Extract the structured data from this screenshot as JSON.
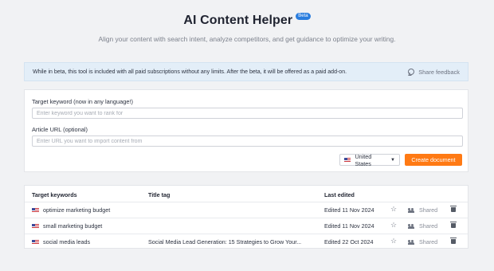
{
  "header": {
    "title": "AI Content Helper",
    "badge": "Beta",
    "subtitle": "Align your content with search intent, analyze competitors, and get guidance to optimize your writing."
  },
  "banner": {
    "text": "While in beta, this tool is included with all paid subscriptions without any limits. After the beta, it will be offered as a paid add-on.",
    "feedback_label": "Share feedback"
  },
  "form": {
    "keyword_label": "Target keyword (now in any language!)",
    "keyword_placeholder": "Enter keyword you want to rank for",
    "keyword_value": "",
    "url_label": "Article URL (optional)",
    "url_placeholder": "Enter URL you want to import content from",
    "url_value": "",
    "country": "United States",
    "create_label": "Create document"
  },
  "table": {
    "headers": {
      "keyword": "Target keywords",
      "title": "Title tag",
      "edited": "Last edited"
    },
    "rows": [
      {
        "keyword": "optimize marketing budget",
        "title": "",
        "edited": "Edited 11 Nov 2024",
        "shared": "Shared"
      },
      {
        "keyword": "small marketing budget",
        "title": "",
        "edited": "Edited 11 Nov 2024",
        "shared": "Shared"
      },
      {
        "keyword": "social media leads",
        "title": "Social Media Lead Generation: 15 Strategies to Grow Your...",
        "edited": "Edited 22 Oct 2024",
        "shared": "Shared"
      }
    ]
  },
  "colors": {
    "accent_orange": "#ff7a14",
    "badge_blue": "#2a7dde",
    "banner_bg": "#e3eef8"
  }
}
